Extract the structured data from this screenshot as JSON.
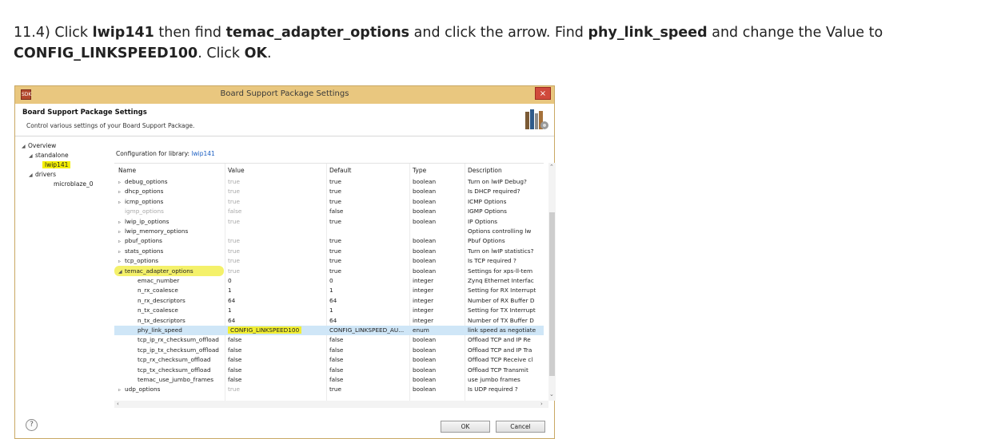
{
  "instruction": {
    "prefix": "11.4) Click ",
    "b1": "lwip141",
    "t1": " then find ",
    "b2": "temac_adapter_options",
    "t2": " and click the arrow. Find ",
    "b3": "phy_link_speed",
    "t3": " and change the Value to ",
    "b4": "CONFIG_LINKSPEED100",
    "t4": ". Click ",
    "b5": "OK",
    "t5": "."
  },
  "window": {
    "title": "Board Support Package Settings",
    "close": "×",
    "app_icon": "SDK",
    "header_title": "Board Support Package Settings",
    "header_subtitle": "Control various settings of your Board Support Package."
  },
  "tree": {
    "overview": "Overview",
    "standalone": "standalone",
    "lwip": "lwip141",
    "drivers": "drivers",
    "microblaze": "microblaze_0"
  },
  "config": {
    "label": "Configuration for library:",
    "library": "lwip141"
  },
  "columns": [
    "Name",
    "Value",
    "Default",
    "Type",
    "Description"
  ],
  "rows": [
    {
      "name": "debug_options",
      "value": "true",
      "default": "true",
      "type": "boolean",
      "desc": "Turn on lwIP Debug?",
      "arrow": "▹",
      "indent": 1,
      "muted_val": true
    },
    {
      "name": "dhcp_options",
      "value": "true",
      "default": "true",
      "type": "boolean",
      "desc": "Is DHCP required?",
      "arrow": "▹",
      "indent": 1,
      "muted_val": true
    },
    {
      "name": "icmp_options",
      "value": "true",
      "default": "true",
      "type": "boolean",
      "desc": "ICMP Options",
      "arrow": "▹",
      "indent": 1,
      "muted_val": true
    },
    {
      "name": "igmp_options",
      "value": "false",
      "default": "false",
      "type": "boolean",
      "desc": "IGMP Options",
      "arrow": "",
      "indent": 1,
      "muted_name": true
    },
    {
      "name": "lwip_ip_options",
      "value": "true",
      "default": "true",
      "type": "boolean",
      "desc": "IP Options",
      "arrow": "▹",
      "indent": 1,
      "muted_val": true
    },
    {
      "name": "lwip_memory_options",
      "value": "",
      "default": "",
      "type": "",
      "desc": "Options controlling lw",
      "arrow": "▹",
      "indent": 1
    },
    {
      "name": "pbuf_options",
      "value": "true",
      "default": "true",
      "type": "boolean",
      "desc": "Pbuf Options",
      "arrow": "▹",
      "indent": 1,
      "muted_val": true
    },
    {
      "name": "stats_options",
      "value": "true",
      "default": "true",
      "type": "boolean",
      "desc": "Turn on lwIP statistics?",
      "arrow": "▹",
      "indent": 1,
      "muted_val": true
    },
    {
      "name": "tcp_options",
      "value": "true",
      "default": "true",
      "type": "boolean",
      "desc": "Is TCP required ?",
      "arrow": "▹",
      "indent": 1,
      "muted_val": true
    },
    {
      "name": "temac_adapter_options",
      "value": "true",
      "default": "true",
      "type": "boolean",
      "desc": "Settings for xps-ll-tem",
      "arrow": "◢",
      "indent": 1,
      "muted_val": true,
      "marker": true
    },
    {
      "name": "emac_number",
      "value": "0",
      "default": "0",
      "type": "integer",
      "desc": "Zynq Ethernet Interfac",
      "arrow": "",
      "indent": 2
    },
    {
      "name": "n_rx_coalesce",
      "value": "1",
      "default": "1",
      "type": "integer",
      "desc": "Setting for RX Interrupt",
      "arrow": "",
      "indent": 2
    },
    {
      "name": "n_rx_descriptors",
      "value": "64",
      "default": "64",
      "type": "integer",
      "desc": "Number of RX Buffer D",
      "arrow": "",
      "indent": 2
    },
    {
      "name": "n_tx_coalesce",
      "value": "1",
      "default": "1",
      "type": "integer",
      "desc": "Setting for TX Interrupt",
      "arrow": "",
      "indent": 2
    },
    {
      "name": "n_tx_descriptors",
      "value": "64",
      "default": "64",
      "type": "integer",
      "desc": "Number of TX Buffer D",
      "arrow": "",
      "indent": 2
    },
    {
      "name": "phy_link_speed",
      "value": "CONFIG_LINKSPEED100",
      "default": "CONFIG_LINKSPEED_AU...",
      "type": "enum",
      "desc": "link speed as negotiate",
      "arrow": "",
      "indent": 2,
      "selected": true,
      "val_hl": true
    },
    {
      "name": "tcp_ip_rx_checksum_offload",
      "value": "false",
      "default": "false",
      "type": "boolean",
      "desc": "Offload TCP and IP Re",
      "arrow": "",
      "indent": 2
    },
    {
      "name": "tcp_ip_tx_checksum_offload",
      "value": "false",
      "default": "false",
      "type": "boolean",
      "desc": "Offload TCP and IP Tra",
      "arrow": "",
      "indent": 2
    },
    {
      "name": "tcp_rx_checksum_offload",
      "value": "false",
      "default": "false",
      "type": "boolean",
      "desc": "Offload TCP Receive cl",
      "arrow": "",
      "indent": 2
    },
    {
      "name": "tcp_tx_checksum_offload",
      "value": "false",
      "default": "false",
      "type": "boolean",
      "desc": "Offload TCP Transmit",
      "arrow": "",
      "indent": 2
    },
    {
      "name": "temac_use_jumbo_frames",
      "value": "false",
      "default": "false",
      "type": "boolean",
      "desc": "use jumbo frames",
      "arrow": "",
      "indent": 2
    },
    {
      "name": "udp_options",
      "value": "true",
      "default": "true",
      "type": "boolean",
      "desc": "Is UDP required ?",
      "arrow": "▹",
      "indent": 1,
      "muted_val": true
    }
  ],
  "buttons": {
    "ok": "OK",
    "cancel": "Cancel",
    "help": "?"
  },
  "colors": {
    "title_bar": "#e9c77f",
    "highlight": "#f5f000",
    "selection": "#cfe6f7",
    "link": "#1a5ec2"
  }
}
